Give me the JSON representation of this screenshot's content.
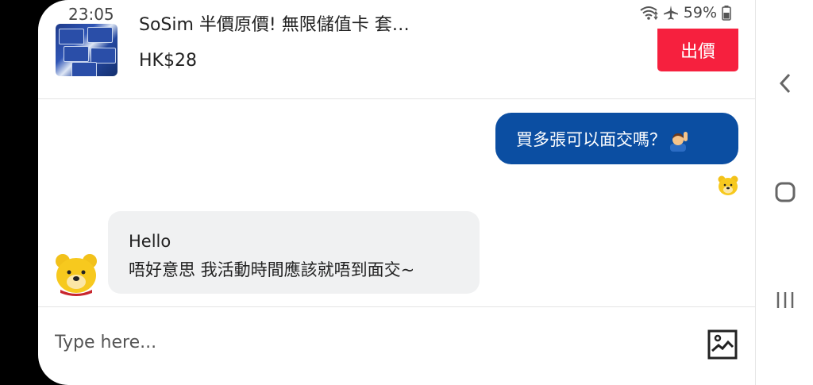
{
  "status": {
    "time": "23:05",
    "battery": "59%"
  },
  "product": {
    "title": "SoSim 半價原價! 無限儲值卡 套…",
    "price": "HK$28",
    "offer_label": "出價"
  },
  "messages": {
    "outgoing": {
      "text": "買多張可以面交嗎？"
    },
    "incoming": {
      "line1": "Hello",
      "line2": "唔好意思 我活動時間應該就唔到面交~"
    }
  },
  "composer": {
    "placeholder": "Type here..."
  },
  "icons": {
    "wifi": "wifi-icon",
    "airplane": "airplane-icon",
    "battery": "battery-icon",
    "back": "back-icon",
    "home": "home-icon",
    "recents": "recents-icon",
    "image": "image-upload-icon",
    "avatar": "bear-avatar-icon",
    "emoji": "person-raising-hand-emoji"
  },
  "colors": {
    "accent_blue": "#0b4ea2",
    "offer_red": "#f6203e",
    "bubble_grey": "#f0f1f2"
  }
}
